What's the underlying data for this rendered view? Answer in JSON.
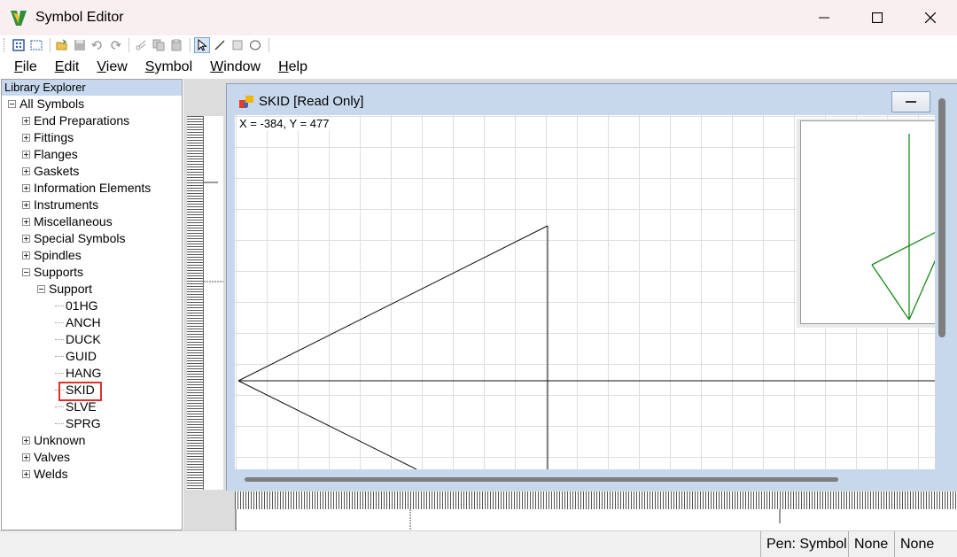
{
  "window": {
    "title": "Symbol Editor"
  },
  "menu": [
    {
      "label": "File",
      "u": "F",
      "rest": "ile"
    },
    {
      "label": "Edit",
      "u": "E",
      "rest": "dit"
    },
    {
      "label": "View",
      "u": "V",
      "rest": "iew"
    },
    {
      "label": "Symbol",
      "u": "S",
      "rest": "ymbol"
    },
    {
      "label": "Window",
      "u": "W",
      "rest": "indow"
    },
    {
      "label": "Help",
      "u": "H",
      "rest": "elp"
    }
  ],
  "explorer": {
    "header": "Library Explorer",
    "root": "All Symbols",
    "categories": [
      "End Preparations",
      "Fittings",
      "Flanges",
      "Gaskets",
      "Information Elements",
      "Instruments",
      "Miscellaneous",
      "Special Symbols",
      "Spindles",
      "Supports"
    ],
    "subcategory": "Support",
    "symbols": [
      "01HG",
      "ANCH",
      "DUCK",
      "GUID",
      "HANG",
      "SKID",
      "SLVE",
      "SPRG"
    ],
    "selected": "SKID",
    "after": [
      "Unknown",
      "Valves",
      "Welds"
    ]
  },
  "document": {
    "title": "SKID [Read Only]",
    "coords": "X = -384, Y = 477"
  },
  "status": {
    "pen": "Pen: Symbol",
    "field2": "None",
    "field3": "None"
  },
  "colors": {
    "preview_stroke": "#1a8a1a",
    "selection": "#e0302a",
    "explorer_header": "#c7d8ee"
  }
}
